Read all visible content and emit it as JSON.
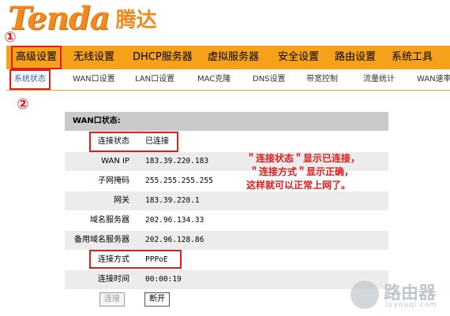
{
  "brand": {
    "logo_en": "Tenda",
    "logo_cn": "腾达",
    "accent": "#f5a21a",
    "highlight": "#e21b1b"
  },
  "markers": {
    "one": "①",
    "two": "②"
  },
  "main_nav": [
    {
      "label": "高级设置",
      "active": true
    },
    {
      "label": "无线设置"
    },
    {
      "label": "DHCP服务器"
    },
    {
      "label": "虚拟服务器"
    },
    {
      "label": "安全设置"
    },
    {
      "label": "路由设置"
    },
    {
      "label": "系统工具"
    }
  ],
  "sub_nav": [
    {
      "label": "系统状态",
      "active": true
    },
    {
      "label": "WAN口设置"
    },
    {
      "label": "LAN口设置"
    },
    {
      "label": "MAC克隆"
    },
    {
      "label": "DNS设置"
    },
    {
      "label": "带宽控制"
    },
    {
      "label": "流量统计"
    },
    {
      "label": "WAN速率"
    }
  ],
  "panel": {
    "title": "WAN口状态:",
    "rows": [
      {
        "label": "连接状态",
        "value": "已连接"
      },
      {
        "label": "WAN IP",
        "value": "183.39.220.183"
      },
      {
        "label": "子网掩码",
        "value": "255.255.255.255"
      },
      {
        "label": "网关",
        "value": "183.39.220.1"
      },
      {
        "label": "域名服务器",
        "value": "202.96.134.33"
      },
      {
        "label": "备用域名服务器",
        "value": "202.96.128.86"
      },
      {
        "label": "连接方式",
        "value": "PPPoE"
      },
      {
        "label": "连接时间",
        "value": "00:00:19"
      }
    ],
    "connect_button": "连接",
    "disconnect_button": "断开"
  },
  "annotation": {
    "line1": "＂连接状态＂显示已连接，",
    "line2": "＂连接方式＂显示正确，",
    "line3": "这样就可以正常上网了。"
  },
  "watermark": {
    "text": "路由器",
    "sub": "luyouqi.com",
    "icon": "router-logo-icon"
  }
}
